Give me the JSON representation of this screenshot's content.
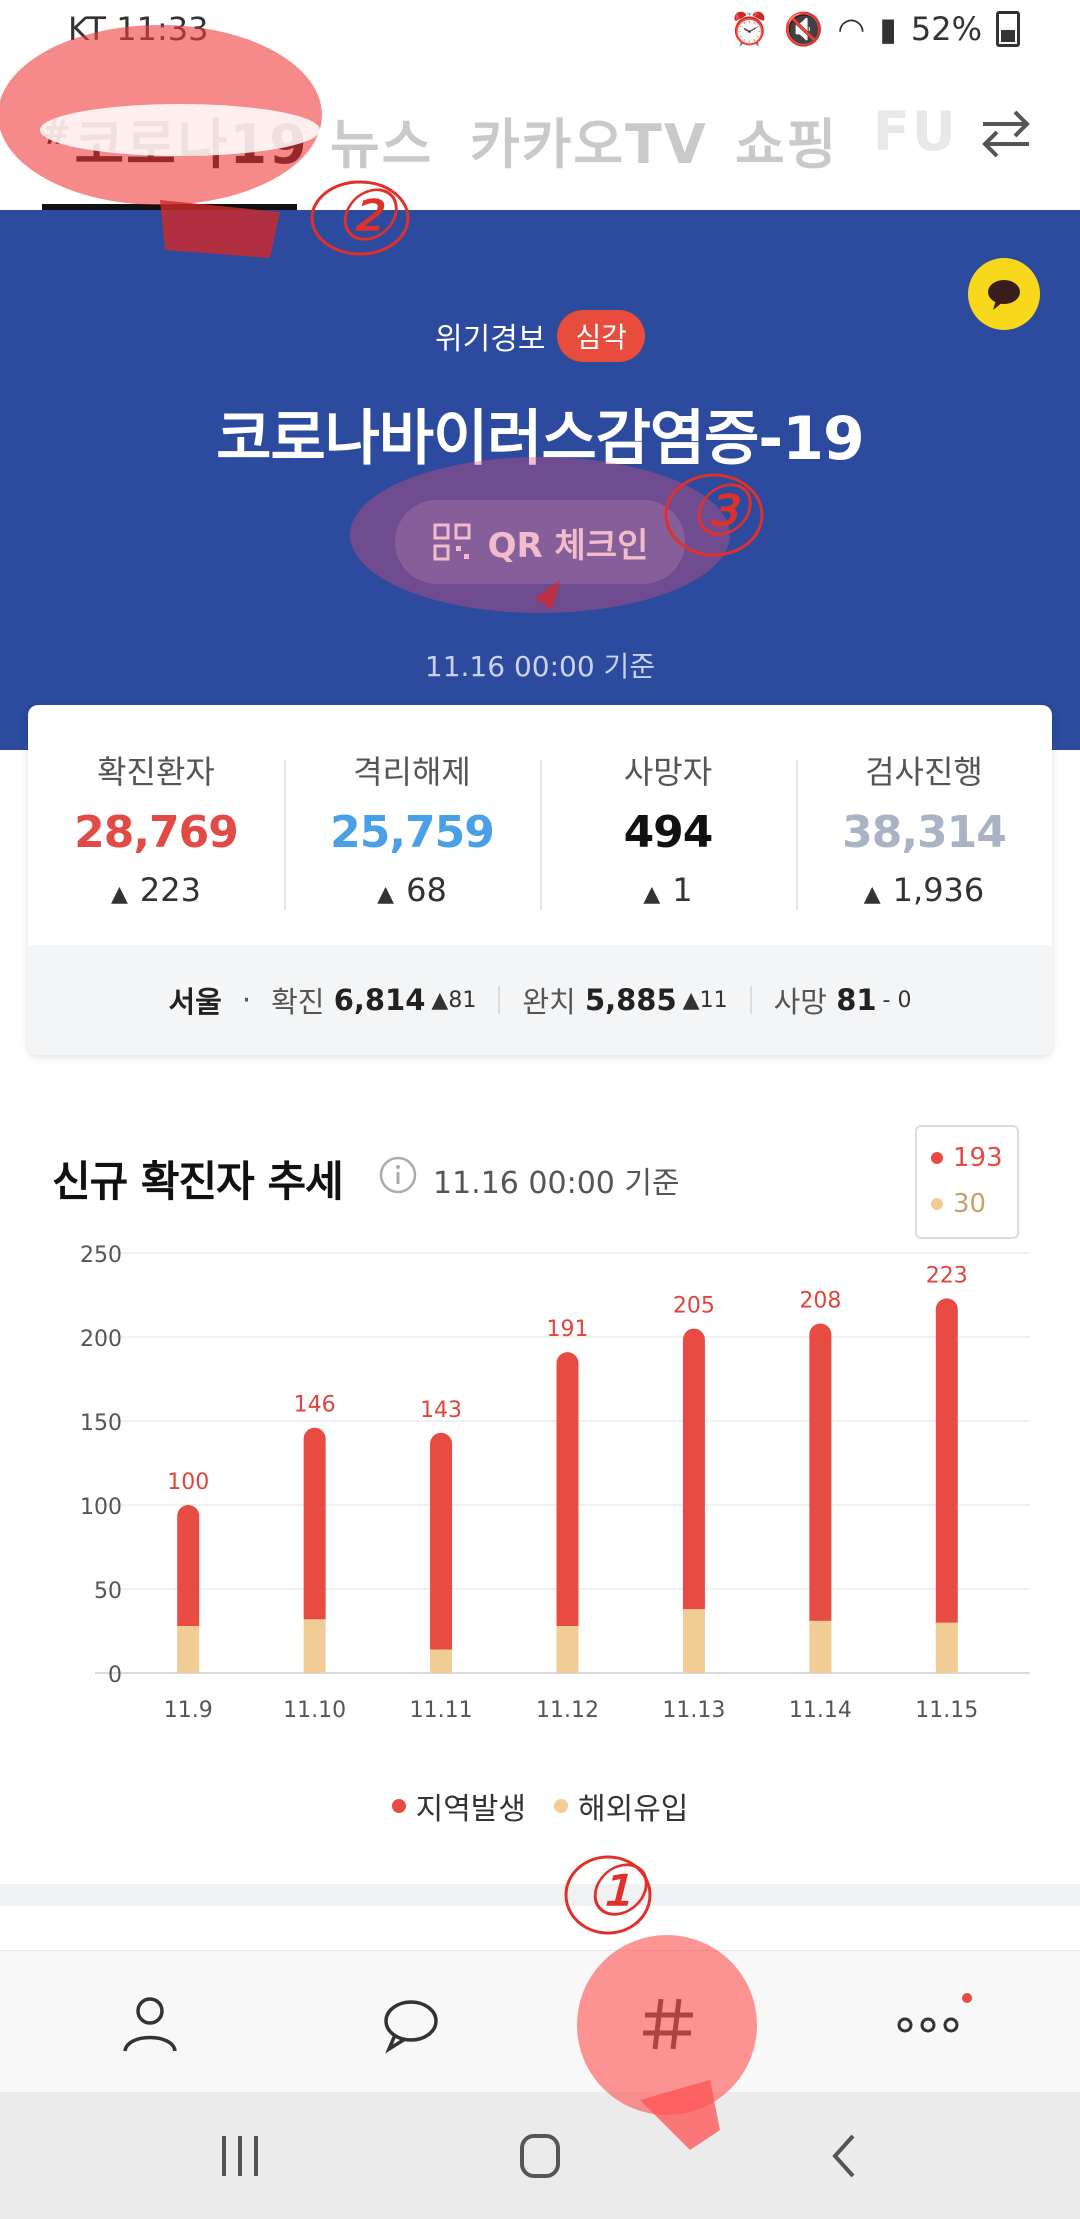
{
  "status_bar": {
    "carrier_time": "KT 11:33",
    "battery": "52%"
  },
  "tabs": [
    {
      "label": "코로나19",
      "prefix": "#",
      "active": true
    },
    {
      "label": "뉴스"
    },
    {
      "label": "카카오TV"
    },
    {
      "label": "쇼핑"
    },
    {
      "label": "FU"
    }
  ],
  "banner": {
    "level_label": "위기경보",
    "level_badge": "심각",
    "title": "코로나바이러스감염증-19",
    "qr_button": "QR 체크인",
    "date": "11.16 00:00 기준"
  },
  "stats": [
    {
      "label": "확진환자",
      "value": "28,769",
      "delta": "223",
      "color": "#e24b45"
    },
    {
      "label": "격리해제",
      "value": "25,759",
      "delta": "68",
      "color": "#4aa0e6"
    },
    {
      "label": "사망자",
      "value": "494",
      "delta": "1",
      "color": "#111111"
    },
    {
      "label": "검사진행",
      "value": "38,314",
      "delta": "1,936",
      "color": "#aab3c4"
    }
  ],
  "region": {
    "name": "서울",
    "confirmed_label": "확진",
    "confirmed": "6,814",
    "confirmed_delta": "81",
    "recovered_label": "완치",
    "recovered": "5,885",
    "recovered_delta": "11",
    "deaths_label": "사망",
    "deaths": "81",
    "deaths_delta": "- 0"
  },
  "chart_section": {
    "title": "신규 확진자 추세",
    "date": "11.16 00:00 기준",
    "tooltip_local": "193",
    "tooltip_imported": "30"
  },
  "chart_data": {
    "type": "bar",
    "stacked": true,
    "categories": [
      "11.9",
      "11.10",
      "11.11",
      "11.12",
      "11.13",
      "11.14",
      "11.15"
    ],
    "series": [
      {
        "name": "해외유입",
        "values": [
          28,
          32,
          14,
          28,
          38,
          31,
          30
        ],
        "color": "#f1cc94"
      },
      {
        "name": "지역발생",
        "values": [
          72,
          114,
          129,
          163,
          167,
          177,
          193
        ],
        "color": "#e84b42"
      }
    ],
    "totals": [
      100,
      146,
      143,
      191,
      205,
      208,
      223
    ],
    "ylim": [
      0,
      250
    ],
    "yticks": [
      0,
      50,
      100,
      150,
      200,
      250
    ],
    "grid": true,
    "legend_position": "bottom"
  },
  "legend": {
    "local": "지역발생",
    "imported": "해외유입"
  },
  "annotations": [
    "①",
    "②",
    "③"
  ],
  "colors": {
    "banner_bg": "#2c4a9e",
    "accent_red": "#e84b42",
    "imported_tan": "#f1cc94",
    "kakao_yellow": "#f8d81a"
  }
}
